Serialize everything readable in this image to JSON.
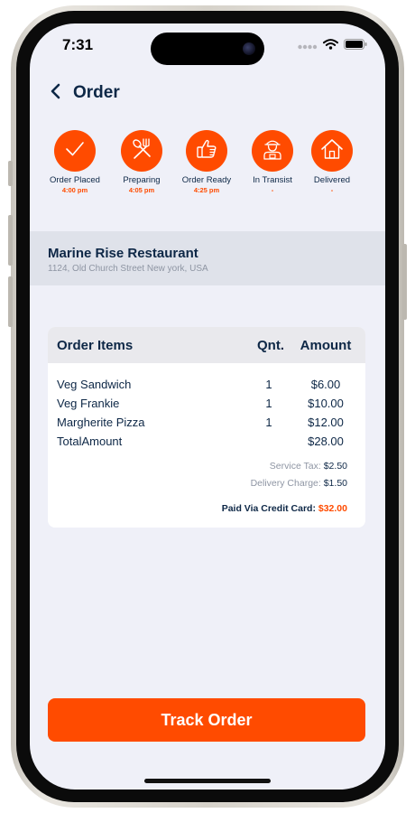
{
  "status_bar": {
    "time": "7:31"
  },
  "nav": {
    "title": "Order",
    "back_icon": "chevron-left-icon"
  },
  "steps": [
    {
      "label": "Order Placed",
      "time": "4:00 pm",
      "icon": "checkmark-icon"
    },
    {
      "label": "Preparing",
      "time": "4:05 pm",
      "icon": "utensils-icon"
    },
    {
      "label": "Order Ready",
      "time": "4:25 pm",
      "icon": "thumbs-up-icon"
    },
    {
      "label": "In Transist",
      "time": "-",
      "icon": "delivery-person-icon"
    },
    {
      "label": "Delivered",
      "time": "-",
      "icon": "home-icon"
    }
  ],
  "restaurant": {
    "name": "Marine Rise Restaurant",
    "address": "1124, Old Church Street New york, USA"
  },
  "order_card": {
    "headers": {
      "items": "Order Items",
      "qty": "Qnt.",
      "amount": "Amount"
    },
    "rows": [
      {
        "name": "Veg Sandwich",
        "qty": "1",
        "amount": "$6.00"
      },
      {
        "name": "Veg Frankie",
        "qty": "1",
        "amount": "$10.00"
      },
      {
        "name": "Margherite Pizza",
        "qty": "1",
        "amount": "$12.00"
      }
    ],
    "total": {
      "label": "TotalAmount",
      "amount": "$28.00"
    },
    "service_tax": {
      "label": "Service Tax:",
      "value": "$2.50"
    },
    "delivery_charge": {
      "label": "Delivery Charge:",
      "value": "$1.50"
    },
    "paid": {
      "label": "Paid Via Credit Card:",
      "value": "$32.00"
    }
  },
  "track_button": {
    "label": "Track Order"
  },
  "colors": {
    "accent": "#ff4b00",
    "text_primary": "#0d2746",
    "screen_bg": "#eff0f8"
  }
}
